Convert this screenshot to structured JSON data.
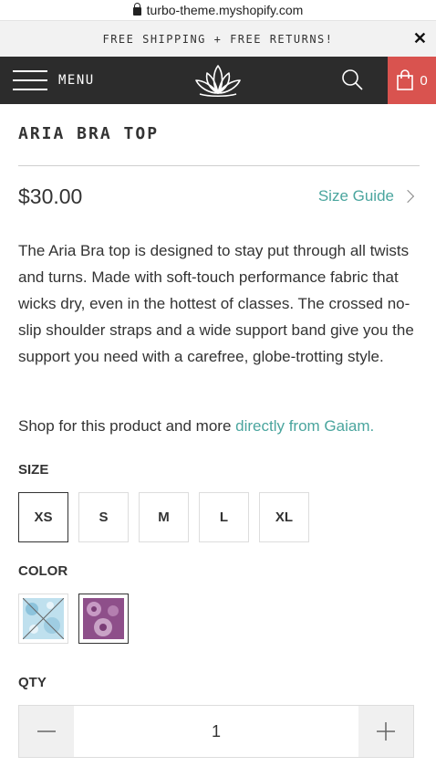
{
  "browser": {
    "url": "turbo-theme.myshopify.com"
  },
  "promo": {
    "text": "FREE SHIPPING + FREE RETURNS!",
    "close_glyph": "✕"
  },
  "header": {
    "menu_label": "MENU",
    "cart_count": "0",
    "cart_color": "#d9534f",
    "bg_color": "#2c2c2c"
  },
  "product": {
    "title": "ARIA BRA TOP",
    "price": "$30.00",
    "size_guide_label": "Size Guide",
    "description": "The Aria Bra top is designed to stay put through all twists and turns. Made with soft-touch performance fabric that wicks dry, even in the hottest of classes. The crossed no-slip shoulder straps and a wide support band give you the support you need with a carefree, globe-trotting style.",
    "shop_prefix": "Shop for this product and more ",
    "shop_link": "directly from Gaiam."
  },
  "options": {
    "size_label": "SIZE",
    "sizes": [
      "XS",
      "S",
      "M",
      "L",
      "XL"
    ],
    "selected_size": "XS",
    "color_label": "COLOR",
    "colors": [
      {
        "name": "light-blue-pattern",
        "hex": "#a9d4e8",
        "available": false
      },
      {
        "name": "purple-pattern",
        "hex": "#9b5a95",
        "available": true,
        "selected": true
      }
    ]
  },
  "quantity": {
    "label": "QTY",
    "value": "1"
  },
  "accent_color": "#4aa59e"
}
